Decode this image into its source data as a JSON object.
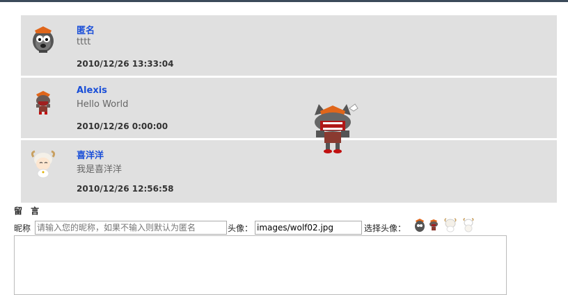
{
  "messages": [
    {
      "name": "匿名",
      "text": "tttt",
      "time": "2010/12/26 13:33:04",
      "avatar": "gray-wolf-avatar-icon"
    },
    {
      "name": "Alexis",
      "text": "Hello World",
      "time": "2010/12/26 0:00:00",
      "avatar": "red-wolf-avatar-icon"
    },
    {
      "name": "喜洋洋",
      "text": "我是喜洋洋",
      "time": "2010/12/26 12:56:58",
      "avatar": "sheep-avatar-icon"
    }
  ],
  "form": {
    "title": "留 言",
    "nick_label": "昵称",
    "nick_placeholder": "请输入您的昵称，如果不输入则默认为匿名",
    "avatar_label": "头像：",
    "avatar_value": "images/wolf02.jpg",
    "choose_label": "选择头像：",
    "choices": [
      "gray-wolf-choice-icon",
      "red-wolf-choice-icon",
      "sheep-choice-icon",
      "white-sheep-choice-icon"
    ]
  },
  "colors": {
    "panel": "#e0e0e0",
    "name": "#1a4fd8",
    "topbar": "#3b4a5a"
  }
}
